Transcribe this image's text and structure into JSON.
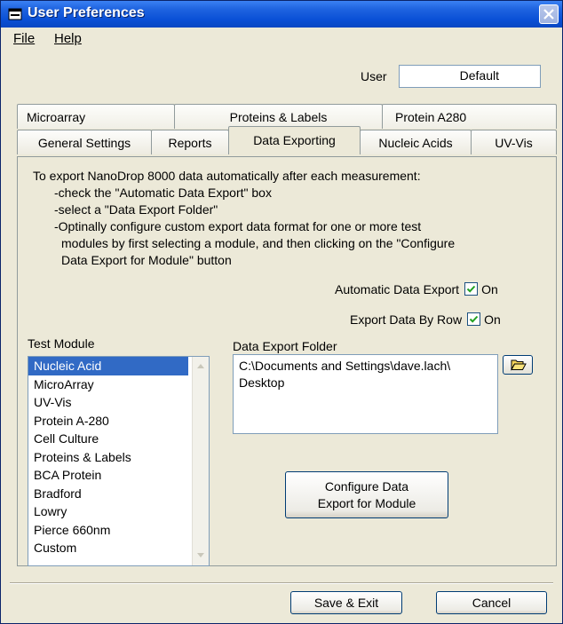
{
  "window": {
    "title": "User Preferences"
  },
  "menu": {
    "file": "File",
    "help": "Help"
  },
  "user": {
    "label": "User",
    "value": "Default"
  },
  "tabs": {
    "row_back": [
      "Microarray",
      "Proteins & Labels",
      "Protein A280"
    ],
    "row_front": [
      "General Settings",
      "Reports",
      "Data Exporting",
      "Nucleic Acids",
      "UV-Vis"
    ],
    "active": "Data Exporting"
  },
  "instructions": {
    "line1": "To export NanoDrop 8000 data automatically after each measurement:",
    "line2": "-check the \"Automatic Data Export\" box",
    "line3": "-select a \"Data Export Folder\"",
    "line4": "-Optinally configure custom export data format for one or more test",
    "line5": "modules by first selecting a module, and then clicking on the \"Configure",
    "line6": "Data Export for Module\" button"
  },
  "options": {
    "auto_export": {
      "label": "Automatic Data Export",
      "checked": true,
      "state_label": "On"
    },
    "export_by_row": {
      "label": "Export Data By Row",
      "checked": true,
      "state_label": "On"
    }
  },
  "test_module": {
    "label": "Test Module",
    "selected": "Nucleic Acid",
    "items": [
      "Nucleic Acid",
      "MicroArray",
      "UV-Vis",
      "Protein A-280",
      "Cell Culture",
      "Proteins & Labels",
      "BCA Protein",
      "Bradford",
      "Lowry",
      "Pierce 660nm",
      "Custom"
    ]
  },
  "export_folder": {
    "label": "Data Export Folder",
    "line1": "C:\\Documents and Settings\\dave.lach\\",
    "line2": "Desktop"
  },
  "buttons": {
    "configure_line1": "Configure Data",
    "configure_line2": "Export for Module",
    "save": "Save & Exit",
    "cancel": "Cancel"
  },
  "colors": {
    "title_bar": "#0A50D6",
    "selection": "#316AC5",
    "dialog_bg": "#ECE9D8"
  },
  "icons": {
    "app": "app-icon",
    "close": "close-icon",
    "folder": "open-folder-icon",
    "scroll_up": "scroll-up-arrow-icon",
    "scroll_down": "scroll-down-arrow-icon",
    "check": "check-icon"
  }
}
